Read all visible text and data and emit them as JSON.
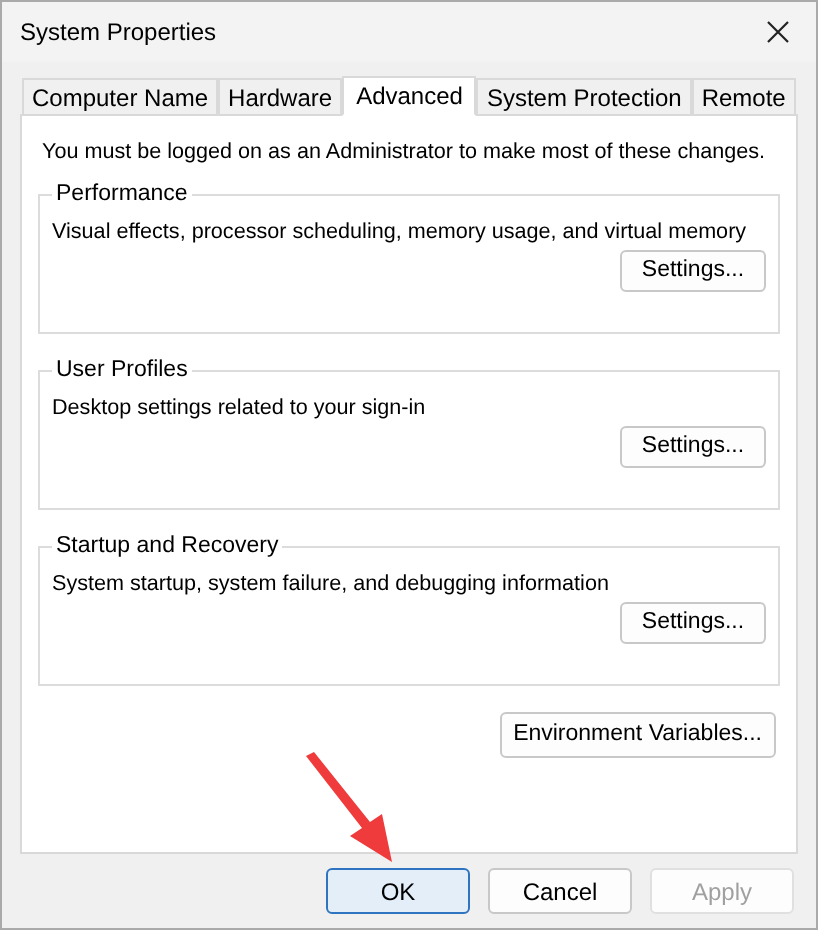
{
  "window": {
    "title": "System Properties"
  },
  "tabs": [
    {
      "label": "Computer Name",
      "selected": false
    },
    {
      "label": "Hardware",
      "selected": false
    },
    {
      "label": "Advanced",
      "selected": true
    },
    {
      "label": "System Protection",
      "selected": false
    },
    {
      "label": "Remote",
      "selected": false
    }
  ],
  "notice": "You must be logged on as an Administrator to make most of these changes.",
  "groups": [
    {
      "title": "Performance",
      "description": "Visual effects, processor scheduling, memory usage, and virtual memory",
      "button": "Settings..."
    },
    {
      "title": "User Profiles",
      "description": "Desktop settings related to your sign-in",
      "button": "Settings..."
    },
    {
      "title": "Startup and Recovery",
      "description": "System startup, system failure, and debugging information",
      "button": "Settings..."
    }
  ],
  "environment_button": "Environment Variables...",
  "buttons": [
    {
      "label": "OK",
      "default": true,
      "disabled": false
    },
    {
      "label": "Cancel",
      "default": false,
      "disabled": false
    },
    {
      "label": "Apply",
      "default": false,
      "disabled": true
    }
  ],
  "annotation": {
    "kind": "arrow"
  }
}
